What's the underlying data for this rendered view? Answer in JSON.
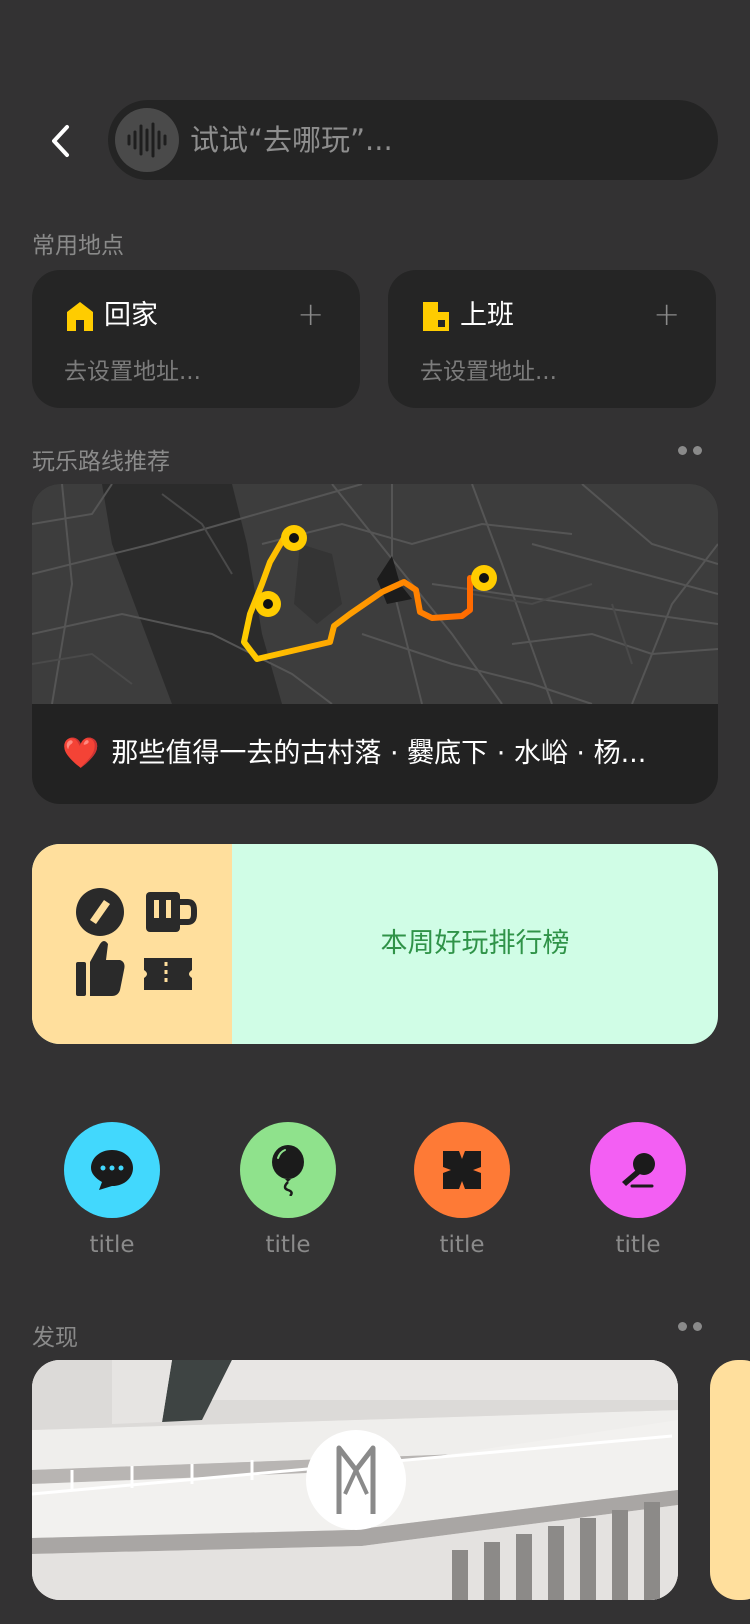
{
  "search": {
    "placeholder": "试试“去哪玩”..."
  },
  "frequent_places": {
    "title": "常用地点",
    "items": [
      {
        "name": "回家",
        "subtitle": "去设置地址...",
        "icon": "home-icon"
      },
      {
        "name": "上班",
        "subtitle": "去设置地址...",
        "icon": "office-icon"
      }
    ]
  },
  "route_recommend": {
    "title": "玩乐路线推荐",
    "caption": "那些值得一去的古村落 · 爨底下 · 水峪 · 杨...",
    "emoji": "❤️"
  },
  "ranking": {
    "label": "本周好玩排行榜"
  },
  "quick_items": [
    {
      "label": "title",
      "icon": "chat-bubble-icon",
      "color": "#42d8fd"
    },
    {
      "label": "title",
      "icon": "balloon-icon",
      "color": "#8fe28c"
    },
    {
      "label": "title",
      "icon": "kite-icon",
      "color": "#fe7a36"
    },
    {
      "label": "title",
      "icon": "microphone-icon",
      "color": "#f35ff3"
    }
  ],
  "discover": {
    "title": "发现"
  },
  "colors": {
    "background": "#333233",
    "card": "#252525",
    "accent_yellow": "#ffcc00",
    "route_orange": "#ff7a00",
    "rank_left_bg": "#ffdf9d",
    "rank_right_bg": "#d0fde6",
    "rank_text": "#2f9348"
  }
}
